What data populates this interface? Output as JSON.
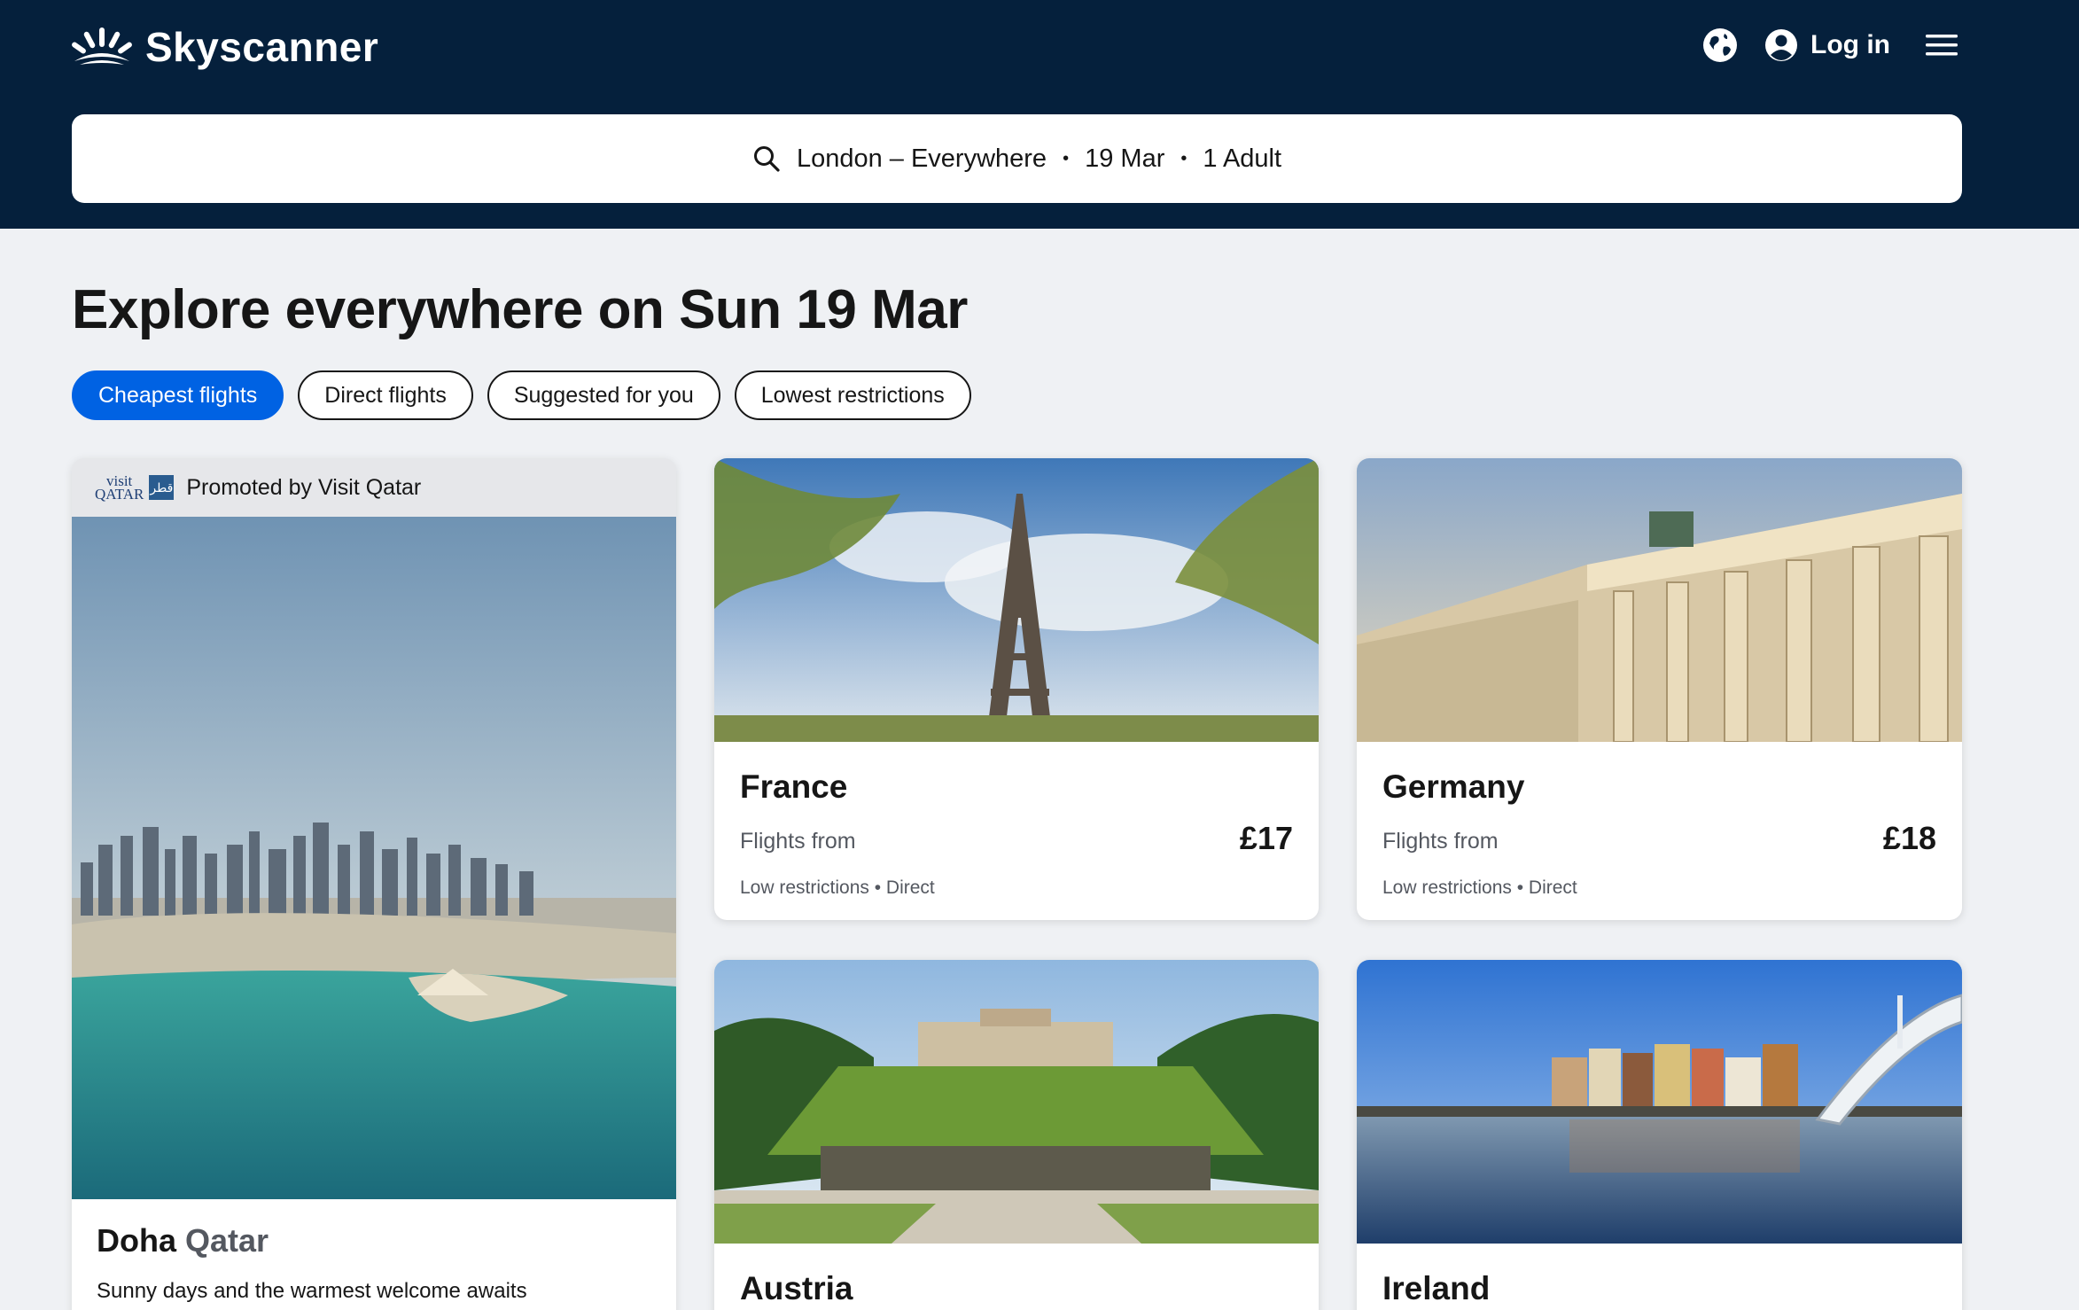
{
  "header": {
    "brand": "Skyscanner",
    "login_label": "Log in",
    "icons": {
      "logo": "skyscanner-sunburst-icon",
      "globe": "globe-icon",
      "account": "account-icon",
      "menu": "hamburger-menu-icon"
    },
    "colors": {
      "background": "#05203c",
      "text": "#ffffff"
    }
  },
  "search": {
    "route": "London – Everywhere",
    "date": "19 Mar",
    "travellers": "1 Adult",
    "separator": "•",
    "icon": "search-icon"
  },
  "page": {
    "title": "Explore everywhere on Sun 19 Mar"
  },
  "filters": [
    {
      "label": "Cheapest flights",
      "active": true
    },
    {
      "label": "Direct flights",
      "active": false
    },
    {
      "label": "Suggested for you",
      "active": false
    },
    {
      "label": "Lowest restrictions",
      "active": false
    }
  ],
  "promo": {
    "sponsor_logo_text": "visit QATAR",
    "label": "Promoted by Visit Qatar",
    "city": "Doha",
    "country": "Qatar",
    "tagline": "Sunny days and the warmest welcome awaits"
  },
  "destinations": [
    {
      "name": "France",
      "from_label": "Flights from",
      "price": "£17",
      "tags": "Low restrictions • Direct"
    },
    {
      "name": "Germany",
      "from_label": "Flights from",
      "price": "£18",
      "tags": "Low restrictions • Direct"
    },
    {
      "name": "Austria"
    },
    {
      "name": "Ireland"
    }
  ],
  "colors": {
    "accent": "#0062e3",
    "page_bg": "#eff1f4"
  }
}
